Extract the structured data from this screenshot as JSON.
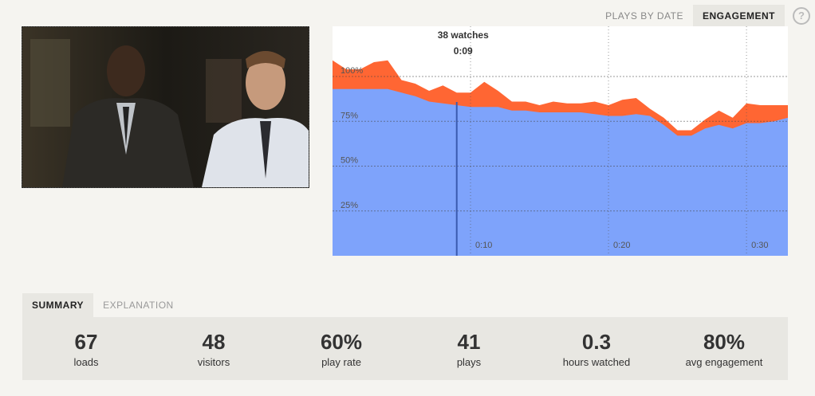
{
  "nav": {
    "tabs": [
      {
        "label": "PLAYS BY DATE",
        "active": false
      },
      {
        "label": "ENGAGEMENT",
        "active": true
      }
    ],
    "help_icon": "?"
  },
  "chart_data": {
    "type": "area",
    "title": "",
    "xlabel": "",
    "ylabel": "",
    "xlim": [
      0,
      33
    ],
    "ylim": [
      0,
      100
    ],
    "y_ticks": [
      "25%",
      "50%",
      "75%",
      "100%"
    ],
    "x_ticks": [
      "0:10",
      "0:20",
      "0:30"
    ],
    "grid": true,
    "series": [
      {
        "color": "#ff6633",
        "x": [
          0,
          1,
          2,
          3,
          4,
          5,
          6,
          7,
          8,
          9,
          10,
          11,
          12,
          13,
          14,
          15,
          16,
          17,
          18,
          19,
          20,
          21,
          22,
          23,
          24,
          25,
          26,
          27,
          28,
          29,
          30,
          31,
          32,
          33
        ],
        "values": [
          109,
          104,
          104,
          108,
          109,
          98,
          96,
          92,
          95,
          91,
          91,
          97,
          92,
          86,
          86,
          84,
          86,
          85,
          85,
          86,
          84,
          87,
          88,
          82,
          77,
          70,
          70,
          76,
          81,
          77,
          85,
          84,
          84,
          84
        ]
      },
      {
        "color": "#7ea3fb",
        "x": [
          0,
          1,
          2,
          3,
          4,
          5,
          6,
          7,
          8,
          9,
          10,
          11,
          12,
          13,
          14,
          15,
          16,
          17,
          18,
          19,
          20,
          21,
          22,
          23,
          24,
          25,
          26,
          27,
          28,
          29,
          30,
          31,
          32,
          33
        ],
        "values": [
          93,
          93,
          93,
          93,
          93,
          91,
          89,
          86,
          85,
          84,
          83,
          83,
          83,
          81,
          81,
          80,
          80,
          80,
          80,
          79,
          78,
          78,
          79,
          78,
          73,
          67,
          67,
          71,
          73,
          71,
          74,
          74,
          75,
          77
        ]
      }
    ],
    "cursor": {
      "x": 9,
      "count_label": "38 watches",
      "time_label": "0:09"
    }
  },
  "bottom_tabs": [
    {
      "label": "SUMMARY",
      "active": true
    },
    {
      "label": "EXPLANATION",
      "active": false
    }
  ],
  "stats": [
    {
      "value": "67",
      "label": "loads"
    },
    {
      "value": "48",
      "label": "visitors"
    },
    {
      "value": "60%",
      "label": "play rate"
    },
    {
      "value": "41",
      "label": "plays"
    },
    {
      "value": "0.3",
      "label": "hours watched"
    },
    {
      "value": "80%",
      "label": "avg engagement"
    }
  ]
}
